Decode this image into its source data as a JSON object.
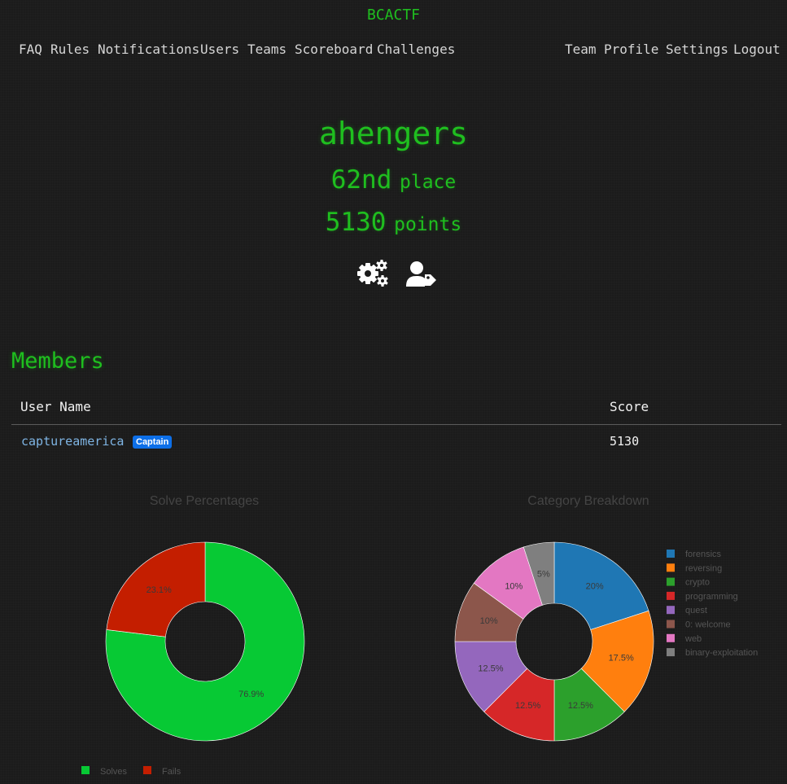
{
  "brand": "BCACTF",
  "nav_left": [
    "FAQ",
    "Rules",
    "Notifications",
    "Users",
    "Teams",
    "Scoreboard",
    "Challenges"
  ],
  "nav_right": [
    "Team",
    "Profile",
    "Settings",
    "Logout"
  ],
  "team": {
    "name": "ahengers",
    "place_value": "62nd",
    "place_label": "place",
    "points_value": "5130",
    "points_label": "points",
    "icons": [
      "settings-gears-icon",
      "user-tag-icon"
    ]
  },
  "members": {
    "title": "Members",
    "columns": [
      "User Name",
      "Score"
    ],
    "rows": [
      {
        "user": "captureamerica",
        "badge": "Captain",
        "score": "5130"
      }
    ]
  },
  "colors": {
    "accent_green": "#1fbf1f",
    "link_blue": "#7fb5e4",
    "badge_blue": "#0d6fe8"
  },
  "chart_data": [
    {
      "type": "pie",
      "title": "Solve Percentages",
      "hole": true,
      "labels": [
        "Solves",
        "Fails"
      ],
      "values": [
        76.9,
        23.1
      ],
      "value_labels": [
        "76.9%",
        "23.1%"
      ],
      "colors": [
        "#07c934",
        "#c41e00"
      ],
      "legend": "bottom"
    },
    {
      "type": "pie",
      "title": "Category Breakdown",
      "hole": true,
      "labels": [
        "forensics",
        "reversing",
        "crypto",
        "programming",
        "quest",
        "0: welcome",
        "web",
        "binary-exploitation"
      ],
      "values": [
        20,
        17.5,
        12.5,
        12.5,
        12.5,
        10,
        10,
        5
      ],
      "value_labels": [
        "20%",
        "17.5%",
        "12.5%",
        "12.5%",
        "12.5%",
        "10%",
        "10%",
        "5%"
      ],
      "colors": [
        "#1f77b4",
        "#ff7f0e",
        "#2ca02c",
        "#d62728",
        "#9467bd",
        "#8c564b",
        "#e377c2",
        "#7f7f7f"
      ],
      "legend": "right"
    }
  ]
}
